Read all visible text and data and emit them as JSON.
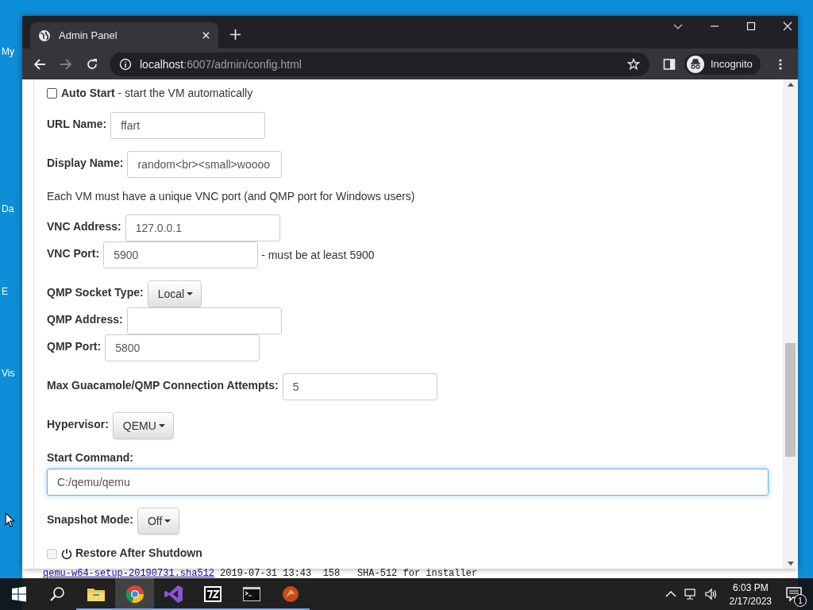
{
  "desktop": {
    "icon_labels": [
      "My",
      "Da",
      "E",
      "Vis"
    ]
  },
  "back_window": {
    "link": "qemu-w64-setup-20190731.sha512",
    "rest": "2019-07-31 13:43  158   SHA-512 for installer"
  },
  "browser": {
    "tab_title": "Admin Panel",
    "url_host": "localhost",
    "url_rest": ":6007/admin/config.html",
    "profile": "Incognito"
  },
  "form": [
    [
      {
        "kind": "checkbox",
        "label": "**Auto Start** - start the VM automatically",
        "checked": false
      }
    ],
    [
      {
        "kind": "input",
        "label": "URL Name:",
        "value": "ffart"
      }
    ],
    [
      {
        "kind": "input",
        "label": "Display Name:",
        "value": "random<br><small>woooo"
      }
    ],
    [
      {
        "kind": "note",
        "text": "Each VM must have a unique VNC port (and QMP port for Windows users)"
      }
    ],
    [
      {
        "kind": "input",
        "label": "VNC Address:",
        "value": "127.0.0.1"
      },
      {
        "kind": "input",
        "label": "VNC Port:",
        "value": "5900",
        "suffix": "- must be at least 5900"
      }
    ],
    [
      {
        "kind": "dropdown",
        "label": "QMP Socket Type:",
        "value": "Local"
      },
      {
        "kind": "input",
        "label": "QMP Address:"
      },
      {
        "kind": "input",
        "label": "QMP Port:",
        "value": "5800"
      }
    ],
    [
      {
        "kind": "input",
        "label": "Max Guacamole/QMP Connection Attempts:",
        "value": "5"
      }
    ],
    [
      {
        "kind": "dropdown",
        "label": "Hypervisor:",
        "value": "QEMU"
      }
    ],
    [
      {
        "kind": "wide",
        "label": "Start Command:",
        "value": "C:/qemu/qemu",
        "focused": true
      }
    ],
    [
      {
        "kind": "dropdown",
        "label": "Snapshot Mode:",
        "value": "Off"
      }
    ],
    [
      {
        "kind": "power-check",
        "label": "Restore After Shutdown",
        "checked": false,
        "disabled": true
      }
    ]
  ],
  "taskbar": {
    "time": "6:03 PM",
    "date": "2/17/2023",
    "notifications": "1"
  }
}
